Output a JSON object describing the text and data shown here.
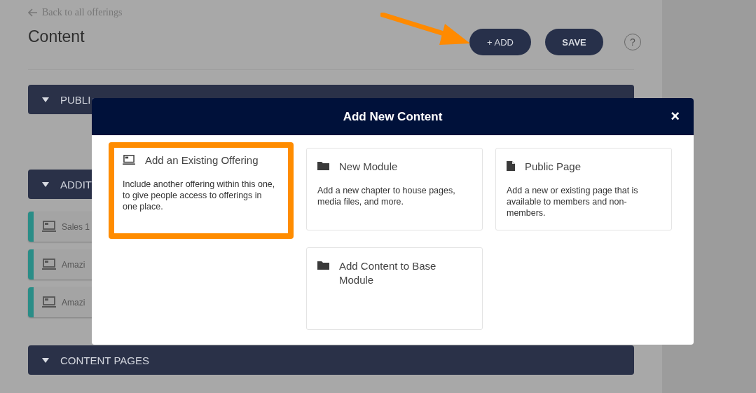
{
  "back_link": "Back to all offerings",
  "page_title": "Content",
  "buttons": [
    {
      "label": "+ ADD",
      "kind": "add"
    },
    {
      "label": "SAVE",
      "kind": "save"
    }
  ],
  "help": "?",
  "sections": [
    {
      "title": "PUBLI"
    },
    {
      "title": "ADDIT",
      "items": [
        {
          "label": "Sales 1"
        },
        {
          "label": "Amazi"
        },
        {
          "label": "Amazi"
        }
      ]
    },
    {
      "title": "CONTENT PAGES"
    }
  ],
  "modal": {
    "title": "Add New Content",
    "close": "×",
    "cards": [
      {
        "kind": "monitor",
        "title": "Add an Existing Offering",
        "description": "Include another offering within this one, to give people access to offerings in one place.",
        "highlighted": true
      },
      {
        "kind": "folder",
        "title": "New Module",
        "description": "Add a new chapter to house pages, media files, and more.",
        "highlighted": false
      },
      {
        "kind": "page",
        "title": "Public Page",
        "description": "Add a new or existing page that is available to members and non-members.",
        "highlighted": false
      },
      {
        "kind": "folder",
        "title": "Add Content to Base Module",
        "highlighted": false
      }
    ]
  }
}
